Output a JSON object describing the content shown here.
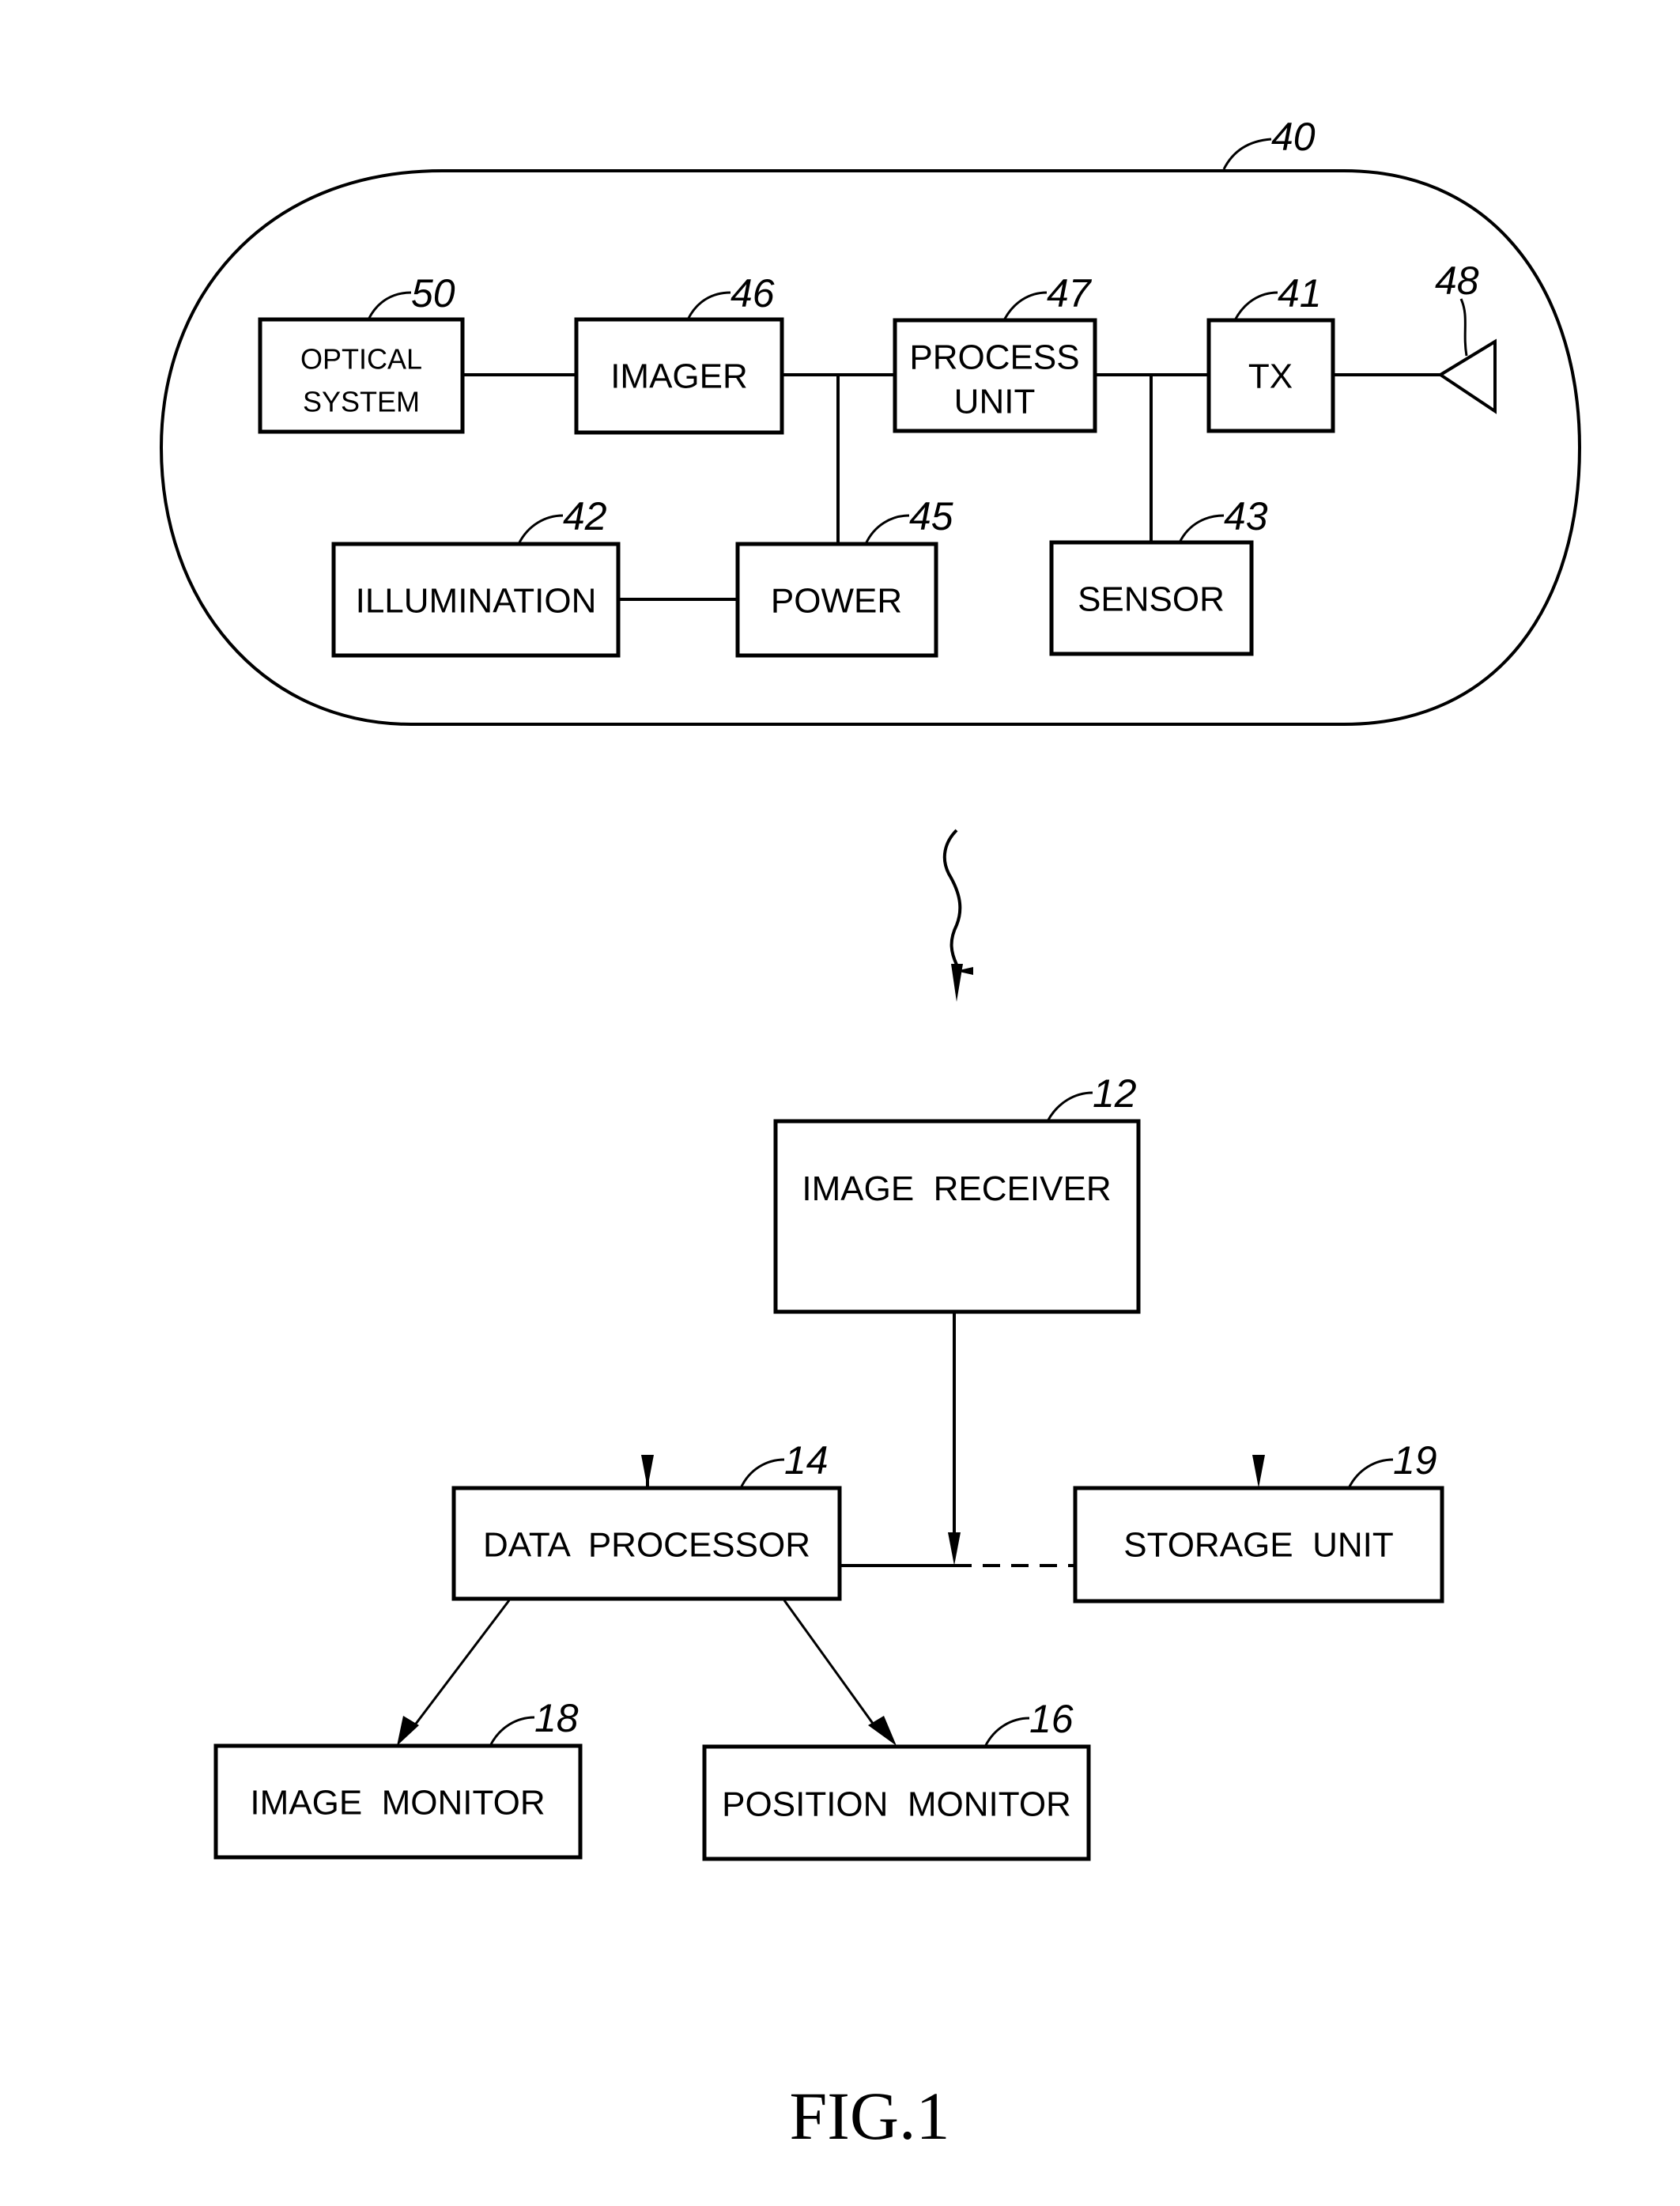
{
  "figure": {
    "caption": "FIG.1",
    "capsule": {
      "ref": "40"
    },
    "antenna": {
      "ref": "48"
    },
    "blocks": {
      "optical_system": {
        "line1": "OPTICAL",
        "line2": "SYSTEM",
        "ref": "50"
      },
      "imager": {
        "label": "IMAGER",
        "ref": "46"
      },
      "process_unit": {
        "line1": "PROCESS",
        "line2": "UNIT",
        "ref": "47"
      },
      "tx": {
        "label": "TX",
        "ref": "41"
      },
      "illumination": {
        "label": "ILLUMINATION",
        "ref": "42"
      },
      "power": {
        "label": "POWER",
        "ref": "45"
      },
      "sensor": {
        "label": "SENSOR",
        "ref": "43"
      },
      "image_receiver": {
        "label": "IMAGE  RECEIVER",
        "ref": "12"
      },
      "data_processor": {
        "label": "DATA  PROCESSOR",
        "ref": "14"
      },
      "storage_unit": {
        "label": "STORAGE  UNIT",
        "ref": "19"
      },
      "image_monitor": {
        "label": "IMAGE  MONITOR",
        "ref": "18"
      },
      "position_monitor": {
        "label": "POSITION  MONITOR",
        "ref": "16"
      }
    },
    "connections": [
      {
        "from": "optical_system",
        "to": "imager",
        "style": "solid"
      },
      {
        "from": "imager",
        "to": "process_unit",
        "style": "solid"
      },
      {
        "from": "imager-process bus",
        "to": "power",
        "style": "solid"
      },
      {
        "from": "illumination",
        "to": "power",
        "style": "solid"
      },
      {
        "from": "process_unit",
        "to": "tx",
        "style": "solid"
      },
      {
        "from": "process-tx bus",
        "to": "sensor",
        "style": "solid"
      },
      {
        "from": "tx",
        "to": "antenna",
        "style": "solid"
      },
      {
        "from": "capsule",
        "to": "image_receiver",
        "style": "wireless"
      },
      {
        "from": "image_receiver",
        "to": "data_processor",
        "style": "solid-arrow"
      },
      {
        "from": "image_receiver",
        "to": "storage_unit",
        "style": "dashed-arrow"
      },
      {
        "from": "data_processor",
        "to": "image_monitor",
        "style": "solid-arrow"
      },
      {
        "from": "data_processor",
        "to": "position_monitor",
        "style": "solid-arrow"
      }
    ]
  }
}
